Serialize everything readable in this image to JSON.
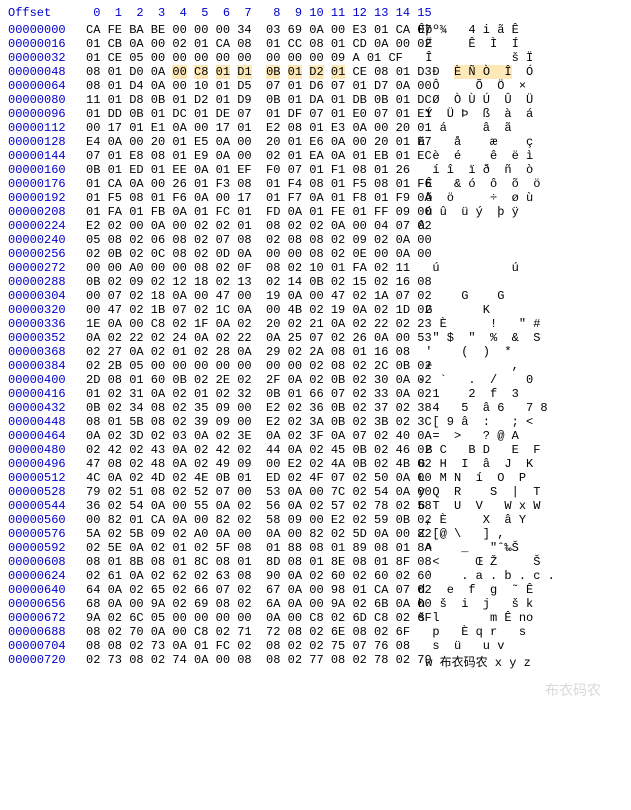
{
  "header": {
    "offset_label": "Offset",
    "columns": " 0  1  2  3  4  5  6  7   8  9 10 11 12 13 14 15"
  },
  "highlight": {
    "row": 3,
    "start": 4,
    "end": 11
  },
  "rows": [
    {
      "offset": "00000000",
      "hex": "CA FE BA BE 00 00 00 34  03 69 0A 00 E3 01 CA 07",
      "ascii": "Êþº¾   4 i ã Ê "
    },
    {
      "offset": "00000016",
      "hex": "01 CB 0A 00 02 01 CA 08  01 CC 08 01 CD 0A 00 02",
      "ascii": " Ë     Ê  Ì  Í   "
    },
    {
      "offset": "00000032",
      "hex": "01 CE 05 00 00 00 00 00  00 00 00 09 A 01 CF",
      "ascii": " Î           š Ï"
    },
    {
      "offset": "00000048",
      "hex": "08 01 D0 0A 00 C8 01 D1  0B 01 D2 01 CE 08 01 D3",
      "ascii": "  Ð  È Ñ Ò  Î  Ó"
    },
    {
      "offset": "00000064",
      "hex": "08 01 D4 0A 00 10 01 D5  07 01 D6 07 01 D7 0A 00",
      "ascii": "  Ô     Õ  Ö  × "
    },
    {
      "offset": "00000080",
      "hex": "11 01 D8 0B 01 D2 01 D9  0B 01 DA 01 DB 0B 01 DC",
      "ascii": "  Ø  Ò Ù Ú  Û  Ü"
    },
    {
      "offset": "00000096",
      "hex": "01 DD 0B 01 DC 01 DE 07  01 DF 07 01 E0 07 01 E1",
      "ascii": " Ý  Ü Þ  ß  à  á"
    },
    {
      "offset": "00000112",
      "hex": "00 17 01 E1 0A 00 17 01  E2 08 01 E3 0A 00 20 01",
      "ascii": "   á     â  ã    "
    },
    {
      "offset": "00000128",
      "hex": "E4 0A 00 20 01 E5 0A 00  20 01 E6 0A 00 20 01 E7",
      "ascii": "ä    å    æ    ç"
    },
    {
      "offset": "00000144",
      "hex": "07 01 E8 08 01 E9 0A 00  02 01 EA 0A 01 EB 01 EC",
      "ascii": "  è  é    ê  ë ì"
    },
    {
      "offset": "00000160",
      "hex": "0B 01 ED 01 EE 0A 01 EF  F0 07 01 F1 08 01 26",
      "ascii": "  í î  ï ð  ñ  ò"
    },
    {
      "offset": "00000176",
      "hex": "01 CA 0A 00 26 01 F3 08  01 F4 08 01 F5 08 01 F6",
      "ascii": " Ê   & ó  ô  õ  ö"
    },
    {
      "offset": "00000192",
      "hex": "01 F5 08 01 F6 0A 00 17  01 F7 0A 01 F8 01 F9 0A",
      "ascii": " õ  ö     ÷  ø ù "
    },
    {
      "offset": "00000208",
      "hex": "01 FA 01 FB 0A 01 FC 01  FD 0A 01 FE 01 FF 09 00",
      "ascii": " ú û  ü ý  þ ÿ  "
    },
    {
      "offset": "00000224",
      "hex": "E2 02 00 0A 00 02 02 01  08 02 02 0A 00 04 07 02",
      "ascii": "â              "
    },
    {
      "offset": "00000240",
      "hex": "05 08 02 06 08 02 07 08  02 08 08 02 09 02 0A 00",
      "ascii": "               "
    },
    {
      "offset": "00000256",
      "hex": "02 0B 02 0C 08 02 0D 0A  00 00 08 02 0E 00 0A 00",
      "ascii": "               "
    },
    {
      "offset": "00000272",
      "hex": "00 00 A0 00 00 08 02 0F  08 02 10 01 FA 02 11",
      "ascii": "  ú          ú  "
    },
    {
      "offset": "00000288",
      "hex": "0B 02 09 02 12 18 02 13  02 14 0B 02 15 02 16 08",
      "ascii": "               "
    },
    {
      "offset": "00000304",
      "hex": "00 07 02 18 0A 00 47 00  19 0A 00 47 02 1A 07 02",
      "ascii": "      G    G    "
    },
    {
      "offset": "00000320",
      "hex": "00 47 02 1B 07 02 1C 0A  00 4B 02 19 0A 02 1D 02",
      "ascii": " G       K      "
    },
    {
      "offset": "00000336",
      "hex": "1E 0A 00 C8 02 1F 0A 02  20 02 21 0A 02 22 02 23",
      "ascii": "   È      !   \" #"
    },
    {
      "offset": "00000352",
      "hex": "0A 02 22 02 24 0A 02 22  0A 25 07 02 26 0A 00 53",
      "ascii": "  \" $  \"  %  &  S"
    },
    {
      "offset": "00000368",
      "hex": "02 27 0A 02 01 02 28 0A  29 02 2A 08 01 16 08",
      "ascii": " '    (  )  *    "
    },
    {
      "offset": "00000384",
      "hex": "02 2B 05 00 00 00 00 00  00 00 02 08 02 2C 0B 02",
      "ascii": " +           ,  "
    },
    {
      "offset": "00000400",
      "hex": "2D 08 01 60 0B 02 2E 02  2F 0A 02 0B 02 30 0A 02",
      "ascii": "-  `   .  /    0 "
    },
    {
      "offset": "00000416",
      "hex": "01 02 31 0A 02 01 02 32  0B 01 66 07 02 33 0A 02",
      "ascii": "  1    2  f  3   "
    },
    {
      "offset": "00000432",
      "hex": "0B 02 34 08 02 35 09 00  E2 02 36 0B 02 37 02 38",
      "ascii": "  4   5  â 6   7 8"
    },
    {
      "offset": "00000448",
      "hex": "08 01 5B 08 02 39 09 00  E2 02 3A 0B 02 3B 02 3C",
      "ascii": "  [ 9 â  :   ; <"
    },
    {
      "offset": "00000464",
      "hex": "0A 02 3D 02 03 0A 02 3E  0A 02 3F 0A 07 02 40 0A",
      "ascii": "  =  >   ? @ A"
    },
    {
      "offset": "00000480",
      "hex": "02 42 02 43 0A 02 42 02  44 0A 02 45 0B 02 46 02",
      "ascii": " B C   B D   E  F "
    },
    {
      "offset": "00000496",
      "hex": "47 08 02 48 0A 02 49 09  00 E2 02 4A 0B 02 4B 02",
      "ascii": "G  H  I  â  J  K "
    },
    {
      "offset": "00000512",
      "hex": "4C 0A 02 4D 02 4E 0B 01  ED 02 4F 07 02 50 0A 00",
      "ascii": "L  M N  í  O  P  "
    },
    {
      "offset": "00000528",
      "hex": "79 02 51 08 02 52 07 00  53 0A 00 7C 02 54 0A 00",
      "ascii": "y Q  R    S  |  T "
    },
    {
      "offset": "00000544",
      "hex": "36 02 54 0A 00 55 0A 02  56 0A 02 57 02 78 02 58",
      "ascii": "6 T  U  V   W x W "
    },
    {
      "offset": "00000560",
      "hex": "00 82 01 CA 0A 00 82 02  58 09 00 E2 02 59 0B 02",
      "ascii": " , È     X  â Y  "
    },
    {
      "offset": "00000576",
      "hex": "5A 02 5B 09 02 A0 0A 00  0A 00 82 02 5D 0A 00 82",
      "ascii": "Z [@ \\   ] ,    "
    },
    {
      "offset": "00000592",
      "hex": "02 5E 0A 02 01 02 5F 08  01 88 08 01 89 08 01 8A",
      "ascii": " ^    _   \"ˆ‰Š"
    },
    {
      "offset": "00000608",
      "hex": "08 01 8B 08 01 8C 08 01  8D 08 01 8E 08 01 8F 08",
      "ascii": "  <     Œ Ž     Š"
    },
    {
      "offset": "00000624",
      "hex": "02 61 0A 02 62 02 63 08  90 0A 02 60 02 60 02 60",
      "ascii": " `    . a . b . c ."
    },
    {
      "offset": "00000640",
      "hex": "64 0A 02 65 02 66 07 02  67 0A 00 98 01 CA 07 02",
      "ascii": "d   e  f  g  ˜ Ê  "
    },
    {
      "offset": "00000656",
      "hex": "68 0A 00 9A 02 69 08 02  6A 0A 00 9A 02 6B 0A 00",
      "ascii": "h  š  i  j   š k  "
    },
    {
      "offset": "00000672",
      "hex": "9A 02 6C 05 00 00 00 00  0A 00 C8 02 6D C8 02 6F",
      "ascii": "š l       m Ê no"
    },
    {
      "offset": "00000688",
      "hex": "08 02 70 0A 00 C8 02 71  72 08 02 6E 08 02 6F",
      "ascii": "  p   È q r   s  "
    },
    {
      "offset": "00000704",
      "hex": "08 08 02 73 0A 01 FC 02  08 02 02 75 07 76 08",
      "ascii": "  s  ü   u v"
    },
    {
      "offset": "00000720",
      "hex": "02 73 08 02 74 0A 00 08  08 02 77 08 02 78 02 79",
      "ascii": " w 布衣码农 x y z"
    }
  ],
  "watermark": "布衣码农"
}
